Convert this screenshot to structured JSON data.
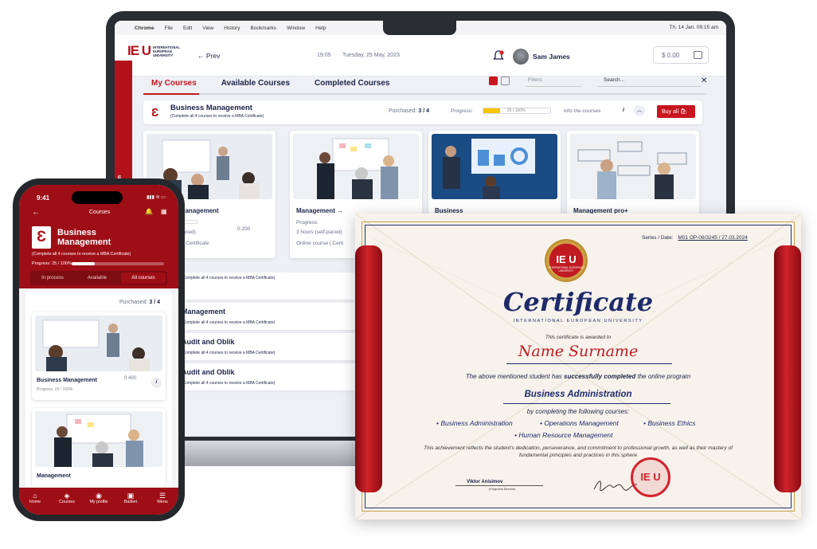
{
  "laptop": {
    "menubar": {
      "app": "Chrome",
      "items": [
        "File",
        "Edit",
        "View",
        "History",
        "Bookmarks",
        "Window",
        "Help"
      ],
      "clock": "Th, 14 Jan. 09:15 am"
    },
    "header": {
      "logo_mark": "IE U",
      "logo_text": "INTERNATIONAL EUROPEAN UNIVERSITY",
      "prev_label": "← Prev",
      "time": "19:05",
      "date": "Tuesday, 25 May, 2023",
      "user_name": "Sam James",
      "balance": "$ 0.00"
    },
    "side_label": "Official Platform",
    "tabs": [
      {
        "label": "My Courses",
        "active": true
      },
      {
        "label": "Available Courses",
        "active": false
      },
      {
        "label": "Completed Courses",
        "active": false
      }
    ],
    "filters_placeholder": "Filters",
    "search_placeholder": "Search...",
    "program": {
      "title": "Business Management",
      "subtitle": "(Complete all 4 courses to receive a MBA Certificate)",
      "purchased_label": "Purchased:",
      "purchased_value": "3 / 4",
      "progress_label": "Progress:",
      "progress_text": "25 / 100%",
      "progress_value": 0.25,
      "info_label": "Info the courses",
      "buy_label": "Buy all"
    },
    "courses": [
      {
        "title": "Business Management",
        "duration": "3 hours (self-paced)",
        "format": "Online course | Certificate",
        "grade": "0 200"
      },
      {
        "title": "Management →",
        "progress": "Progress:",
        "duration": "3 hours (self-paced)",
        "format": "Online course | Certi"
      },
      {
        "title": "Business"
      },
      {
        "title": "Management pro+"
      }
    ],
    "rows": [
      {
        "subtitle": "(Complete all 4 courses to receive a MBA Certificate)"
      },
      {
        "title": "Management",
        "subtitle": "(Complete all 4 courses to receive a MBA Certificate)"
      },
      {
        "title": "Audit and Oblik",
        "subtitle": "(Complete all 4 courses to receive a MBA Certificate)"
      },
      {
        "title": "Audit and Oblik",
        "subtitle": "(Complete all 4 courses to receive a MBA Certificate)"
      }
    ]
  },
  "phone": {
    "time": "9:41",
    "status": "▮▮▮ ≋ ▭",
    "heading": "Courses",
    "program_title": "Business Management",
    "program_subtitle": "(Complete all 4 courses to receive a MBA Certificate)",
    "progress_label": "Progress: 25 / 100%",
    "segments": [
      "In process",
      "Available",
      "All courses"
    ],
    "purchased_label": "Purchased:",
    "purchased_value": "3 / 4",
    "cards": [
      {
        "title": "Business Management",
        "progress": "Progress: 25 / 100%",
        "grade": "0 400"
      },
      {
        "title": "Management"
      }
    ],
    "nav": [
      {
        "icon": "home-icon",
        "label": "Home"
      },
      {
        "icon": "courses-icon",
        "label": "Courses"
      },
      {
        "icon": "profile-icon",
        "label": "My profile"
      },
      {
        "icon": "basket-icon",
        "label": "Basket"
      },
      {
        "icon": "menu-icon",
        "label": "Menu"
      }
    ]
  },
  "certificate": {
    "series_label": "Series / Date:",
    "series_value": "M01 OP-06/3245 / 27.03.2024",
    "seal_text": "IE U",
    "seal_sub": "INTERNATIONAL EUROPEAN UNIVERSITY",
    "heading": "Certificate",
    "university": "INTERNATIONAL EUROPEAN UNIVERSITY",
    "awarded_to": "This certificate is awarded to",
    "name": "Name Surname",
    "statement_pre": "The above mentioned student has ",
    "statement_bold": "successfully completed",
    "statement_post": " the online program",
    "program": "Business Administration",
    "courses_label": "by completing the following courses:",
    "courses": [
      "• Business Administration",
      "• Operations Management",
      "• Business Ethics",
      "• Human Resource Management"
    ],
    "achievement": "This achievement reflects the student's dedication, perseverance, and commitment to professional growth, as well as their mastery of fundamental principles and practices in this sphere",
    "signer": "Viktor Anisimov",
    "signer_role": "(Programs Director)",
    "stamp_text": "IE U"
  },
  "colors": {
    "brand_red": "#b3121b",
    "navy": "#1c2348",
    "gold": "#c9a34d"
  }
}
